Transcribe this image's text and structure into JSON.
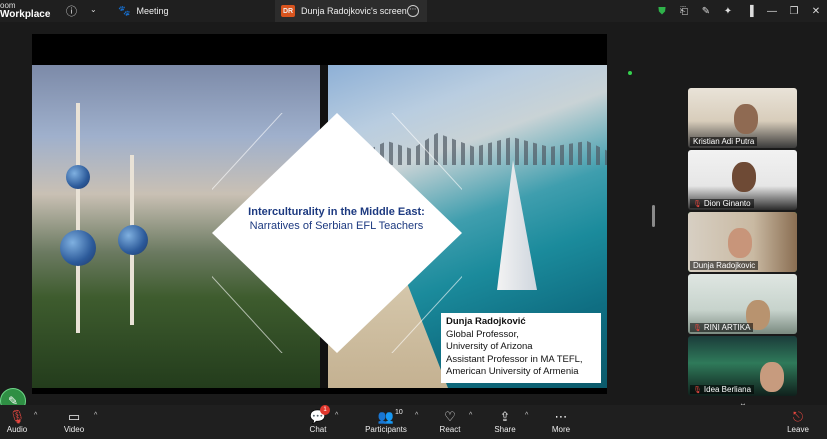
{
  "app": {
    "brand_line1": "oom",
    "brand_line2": "Workplace"
  },
  "tabs": [
    {
      "label": "Meeting",
      "icon": "paw-icon"
    },
    {
      "label": "Dunja Radojkovic's screen",
      "badge": "DR",
      "badge_color": "#d9541e"
    }
  ],
  "slide": {
    "title_bold": "Interculturality in the Middle East:",
    "title_rest": "Narratives of Serbian EFL Teachers",
    "presenter_name": "Dunja Radojković",
    "line1": "Global Professor,",
    "line2": "University of Arizona",
    "line3": "Assistant Professor in MA TEFL,",
    "line4": "American University of Armenia",
    "title_color": "#1d3a80"
  },
  "participants": [
    {
      "name": "Kristian Adi Putra",
      "muted": false,
      "active": false
    },
    {
      "name": "Dion Ginanto",
      "muted": true,
      "active": false
    },
    {
      "name": "Dunja Radojkovic",
      "muted": false,
      "active": true
    },
    {
      "name": "RINI ARTIKA",
      "muted": true,
      "active": false
    },
    {
      "name": "Idea Berliana",
      "muted": true,
      "active": false
    }
  ],
  "toolbar": {
    "audio": "Audio",
    "video": "Video",
    "chat": "Chat",
    "chat_badge": "1",
    "participants": "Participants",
    "participants_count": "10",
    "react": "React",
    "share": "Share",
    "more": "More",
    "leave": "Leave"
  },
  "colors": {
    "active_speaker": "#35c04a",
    "leave": "#e3463f",
    "shield": "#2fb24a"
  }
}
